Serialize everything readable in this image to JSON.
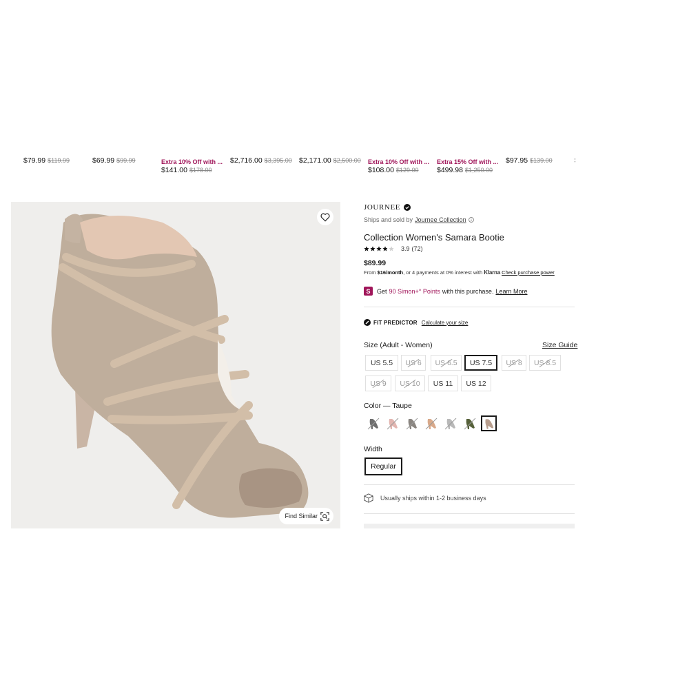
{
  "strip": [
    {
      "promo": "",
      "price": "$79.99",
      "was": "$119.99"
    },
    {
      "promo": "",
      "price": "$69.99",
      "was": "$99.99"
    },
    {
      "promo": "Extra 10% Off with ...",
      "price": "$141.00",
      "was": "$178.00"
    },
    {
      "promo": "",
      "price": "$2,716.00",
      "was": "$3,395.00"
    },
    {
      "promo": "",
      "price": "$2,171.00",
      "was": "$2,500.00"
    },
    {
      "promo": "Extra 10% Off with ...",
      "price": "$108.00",
      "was": "$129.00"
    },
    {
      "promo": "Extra 15% Off with ...",
      "price": "$499.98",
      "was": "$1,250.00"
    },
    {
      "promo": "",
      "price": "$97.95",
      "was": "$139.00"
    },
    {
      "promo": "",
      "price": "$",
      "was": ""
    }
  ],
  "hero": {
    "find_similar": "Find Similar",
    "wishlist_icon": "heart-icon",
    "find_similar_icon": "visual-search-icon"
  },
  "product": {
    "brand": "JOURNEE",
    "sold_prefix": "Ships and sold by",
    "seller": "Journee Collection",
    "title": "Collection Women's Samara Bootie",
    "rating": "3.9",
    "review_count": "(72)",
    "rating_stars": 3.9,
    "price": "$89.99",
    "finance_from": "From",
    "finance_monthly": "$16/month",
    "finance_rest": ", or 4 payments at 0% interest with",
    "finance_provider": "Klarna",
    "finance_link": "Check purchase power",
    "points_get": "Get",
    "points_value": "90 Simon+° Points",
    "points_rest": "with this purchase.",
    "points_link": "Learn More",
    "fit_label": "FIT PREDICTOR",
    "fit_link": "Calculate your size",
    "size_label": "Size (Adult - Women)",
    "size_guide": "Size Guide",
    "sizes": [
      {
        "label": "US 5.5",
        "state": "available"
      },
      {
        "label": "US 6",
        "state": "out-of-stock"
      },
      {
        "label": "US 6.5",
        "state": "out-of-stock"
      },
      {
        "label": "US 7.5",
        "state": "selected"
      },
      {
        "label": "US 8",
        "state": "out-of-stock"
      },
      {
        "label": "US 8.5",
        "state": "out-of-stock"
      },
      {
        "label": "US 9",
        "state": "out-of-stock"
      },
      {
        "label": "US 10",
        "state": "out-of-stock"
      },
      {
        "label": "US 11",
        "state": "available"
      },
      {
        "label": "US 12",
        "state": "available"
      }
    ],
    "color_label": "Color — Taupe",
    "swatches": [
      {
        "color": "#6f6f6f",
        "state": "out-of-stock"
      },
      {
        "color": "#e2b5b0",
        "state": "out-of-stock"
      },
      {
        "color": "#8a8580",
        "state": "out-of-stock"
      },
      {
        "color": "#d9a98a",
        "state": "out-of-stock"
      },
      {
        "color": "#b9b9b9",
        "state": "out-of-stock"
      },
      {
        "color": "#56613a",
        "state": "out-of-stock"
      },
      {
        "color": "#b89e8e",
        "state": "selected"
      }
    ],
    "width_label": "Width",
    "width_value": "Regular",
    "ships_text": "Usually ships within 1-2 business days"
  },
  "colors": {
    "accent": "#a0165a",
    "selected_border": "#1a1a1a",
    "image_bg": "#efeeec"
  }
}
